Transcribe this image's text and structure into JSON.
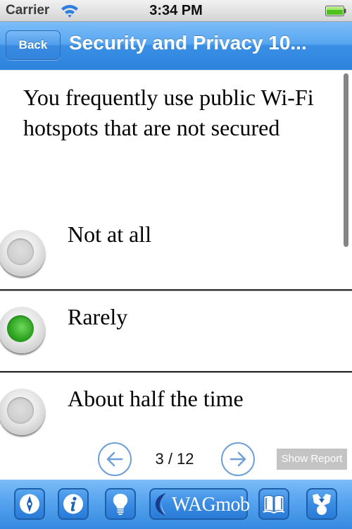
{
  "status_bar": {
    "carrier": "Carrier",
    "time": "3:34 PM",
    "icons": [
      "wifi-icon",
      "battery-icon"
    ]
  },
  "nav_bar": {
    "back_label": "Back",
    "title": "Security and Privacy 10..."
  },
  "question": {
    "text": "You frequently use public Wi-Fi hotspots that are not secured"
  },
  "options": [
    {
      "label": "Not at all",
      "selected": false
    },
    {
      "label": "Rarely",
      "selected": true
    },
    {
      "label": "About half the time",
      "selected": false
    }
  ],
  "pager": {
    "current": 3,
    "total": 12,
    "counter_text": "3 / 12",
    "prev_icon": "arrow-left-icon",
    "next_icon": "arrow-right-icon",
    "show_report_label": "Show Report"
  },
  "toolbar": {
    "items": [
      {
        "name": "compass",
        "icon": "compass-icon"
      },
      {
        "name": "info",
        "icon": "info-icon"
      },
      {
        "name": "tips",
        "icon": "lightbulb-icon"
      },
      {
        "name": "wagmob",
        "label": "WAGmob",
        "icon": "wagmob-logo-icon"
      },
      {
        "name": "book",
        "icon": "book-icon"
      },
      {
        "name": "award",
        "icon": "award-icon"
      }
    ]
  },
  "colors": {
    "nav_blue": "#3a8fe4",
    "selected_green": "#2fa522",
    "pager_blue": "#6f9fd8",
    "show_report_bg": "#c4c4c4"
  }
}
